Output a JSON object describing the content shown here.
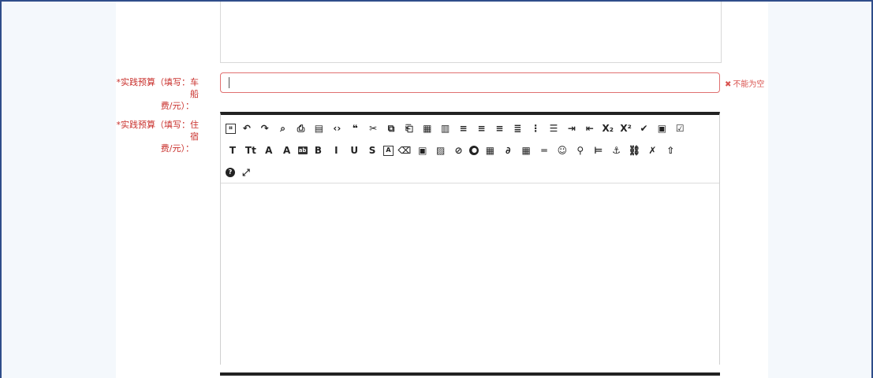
{
  "form": {
    "field_a": {
      "required_mark": "*",
      "label_line1": "实践预算（填写：车船",
      "label_line2": "费/元）：",
      "value": "",
      "error_icon": "✖",
      "error_text": "不能为空"
    },
    "field_b": {
      "required_mark": "*",
      "label_line1": "实践预算（填写：住宿",
      "label_line2": "费/元）："
    }
  },
  "colors": {
    "error": "#d9534f",
    "label": "#c9302c",
    "frame": "#2f4d8a",
    "toolbar_border": "#222222"
  },
  "toolbar": {
    "row1": [
      {
        "name": "source-code-icon",
        "glyph": "⌗"
      },
      {
        "name": "undo-icon",
        "glyph": "↶"
      },
      {
        "name": "redo-icon",
        "glyph": "↷"
      },
      {
        "name": "preview-icon",
        "glyph": "⌕"
      },
      {
        "name": "print-icon",
        "glyph": "⎙"
      },
      {
        "name": "template-icon",
        "glyph": "▤"
      },
      {
        "name": "code-icon",
        "glyph": "‹›"
      },
      {
        "name": "blockquote-icon",
        "glyph": "❝"
      },
      {
        "name": "cut-icon",
        "glyph": "✂"
      },
      {
        "name": "copy-icon",
        "glyph": "⧉"
      },
      {
        "name": "paste-icon",
        "glyph": "⎗"
      },
      {
        "name": "paste-text-icon",
        "glyph": "▦"
      },
      {
        "name": "paste-word-icon",
        "glyph": "▥"
      },
      {
        "name": "align-left-icon",
        "glyph": "≡"
      },
      {
        "name": "align-center-icon",
        "glyph": "≡"
      },
      {
        "name": "align-right-icon",
        "glyph": "≡"
      },
      {
        "name": "align-justify-icon",
        "glyph": "≣"
      },
      {
        "name": "ordered-list-icon",
        "glyph": "⋮"
      },
      {
        "name": "unordered-list-icon",
        "glyph": "☰"
      },
      {
        "name": "indent-icon",
        "glyph": "⇥"
      },
      {
        "name": "outdent-icon",
        "glyph": "⇤"
      },
      {
        "name": "subscript-icon",
        "glyph": "X₂"
      },
      {
        "name": "superscript-icon",
        "glyph": "X²"
      },
      {
        "name": "clear-format-icon",
        "glyph": "✔"
      },
      {
        "name": "select-all-icon",
        "glyph": "▣"
      },
      {
        "name": "checkbox-icon",
        "glyph": "☑"
      }
    ],
    "row2": [
      {
        "name": "title-icon",
        "glyph": "T"
      },
      {
        "name": "font-size-icon",
        "glyph": "Tt"
      },
      {
        "name": "font-family-icon",
        "glyph": "A"
      },
      {
        "name": "font-color-icon",
        "glyph": "A"
      },
      {
        "name": "highlight-icon",
        "glyph": "ab"
      },
      {
        "name": "bold-icon",
        "glyph": "B"
      },
      {
        "name": "italic-icon",
        "glyph": "I"
      },
      {
        "name": "underline-icon",
        "glyph": "U"
      },
      {
        "name": "strikethrough-icon",
        "glyph": "S"
      },
      {
        "name": "line-height-icon",
        "glyph": "A"
      },
      {
        "name": "eraser-icon",
        "glyph": "⌫"
      },
      {
        "name": "image-icon",
        "glyph": "▣"
      },
      {
        "name": "multi-image-icon",
        "glyph": "▨"
      },
      {
        "name": "flash-icon",
        "glyph": "⊘"
      },
      {
        "name": "media-icon",
        "glyph": "●"
      },
      {
        "name": "video-icon",
        "glyph": "▦"
      },
      {
        "name": "attachment-icon",
        "glyph": "∂"
      },
      {
        "name": "table-icon",
        "glyph": "▦"
      },
      {
        "name": "hr-icon",
        "glyph": "═"
      },
      {
        "name": "emoticon-icon",
        "glyph": "☺"
      },
      {
        "name": "map-icon",
        "glyph": "⚲"
      },
      {
        "name": "page-break-icon",
        "glyph": "⊨"
      },
      {
        "name": "anchor-icon",
        "glyph": "⚓"
      },
      {
        "name": "link-icon",
        "glyph": "⛓"
      },
      {
        "name": "unlink-icon",
        "glyph": "✗"
      },
      {
        "name": "upload-icon",
        "glyph": "⇧"
      }
    ],
    "row3": [
      {
        "name": "help-icon",
        "glyph": "?"
      },
      {
        "name": "fullscreen-icon",
        "glyph": "⤢"
      }
    ]
  }
}
